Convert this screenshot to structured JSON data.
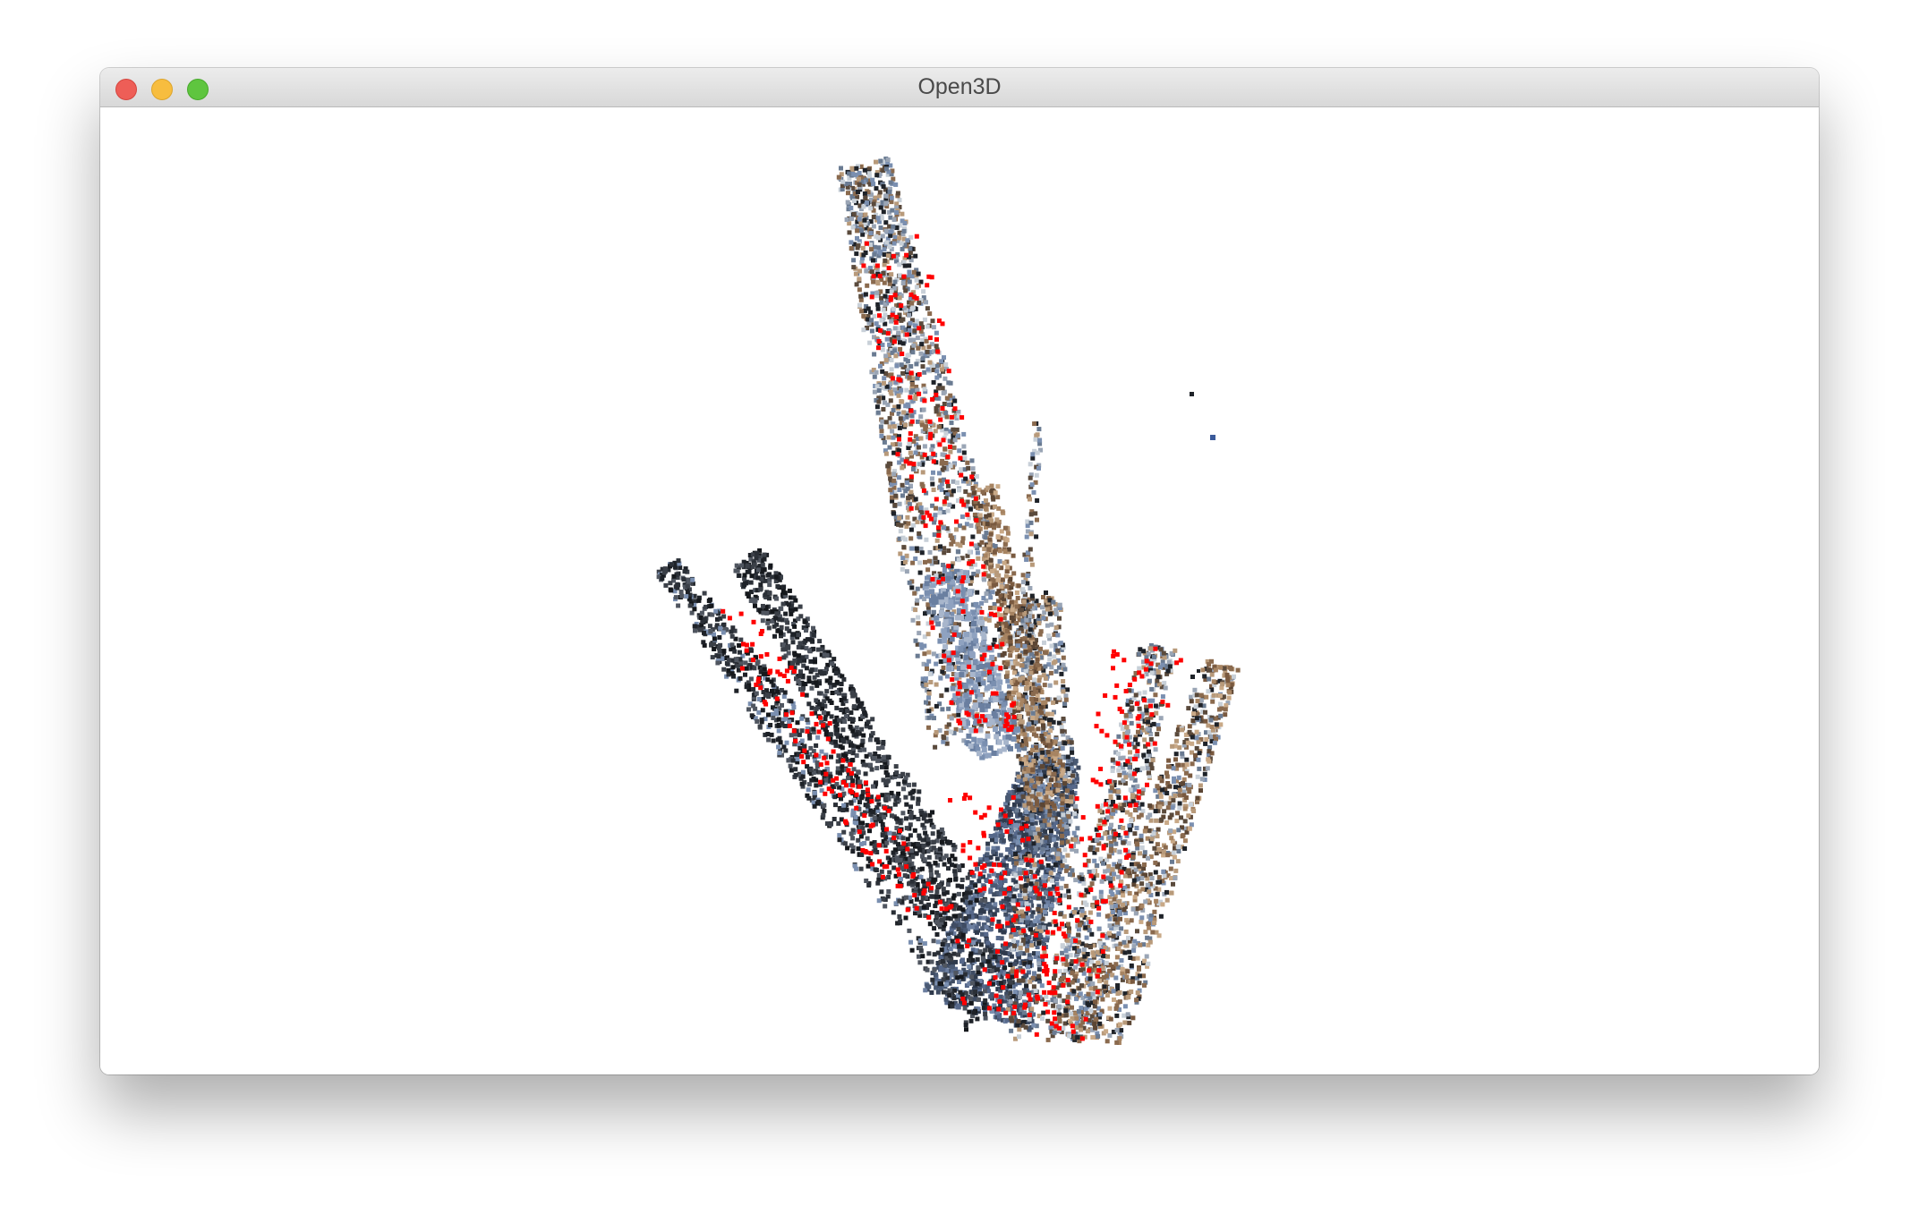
{
  "window": {
    "title": "Open3D",
    "controls": {
      "close": "close-button",
      "minimize": "minimize-button",
      "zoom": "zoom-button"
    }
  },
  "viewport": {
    "background": "#ffffff",
    "content": "point-cloud",
    "point_colors": {
      "road": "#4a5a74",
      "dark": "#1e2228",
      "blue_gray": "#7a8fb0",
      "brown": "#8a6a4e",
      "tan": "#b89a7a",
      "light": "#c8d0d8",
      "keypoint": "#ff0000"
    }
  }
}
